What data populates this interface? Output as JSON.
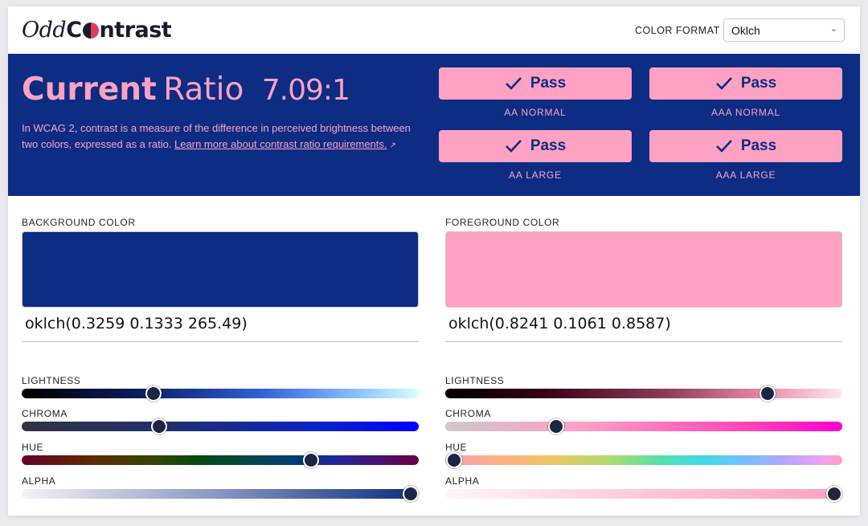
{
  "header": {
    "logo_odd": "Odd",
    "logo_c": "C",
    "logo_rest": "ntrast",
    "color_format_label": "COLOR FORMAT",
    "color_format_value": "Oklch"
  },
  "banner": {
    "title_strong": "Current",
    "title_ratio": "Ratio",
    "ratio_value": "7.09:1",
    "description": "In WCAG 2, contrast is a measure of the difference in perceived brightness between two colors, expressed as a ratio.",
    "learn_more": "Learn more about contrast ratio requirements.",
    "results": [
      {
        "label": "Pass",
        "caption": "AA NORMAL"
      },
      {
        "label": "Pass",
        "caption": "AAA NORMAL"
      },
      {
        "label": "Pass",
        "caption": "AA LARGE"
      },
      {
        "label": "Pass",
        "caption": "AAA LARGE"
      }
    ]
  },
  "background": {
    "label": "BACKGROUND COLOR",
    "swatch_color": "#0c2d83",
    "value": "oklch(0.3259 0.1333 265.49)",
    "sliders": [
      {
        "label": "LIGHTNESS",
        "level": 0.3259
      },
      {
        "label": "CHROMA",
        "level": 0.34
      },
      {
        "label": "HUE",
        "level": 0.7375
      },
      {
        "label": "ALPHA",
        "level": 1.0
      }
    ]
  },
  "foreground": {
    "label": "FOREGROUND COLOR",
    "swatch_color": "#ffa1c2",
    "value": "oklch(0.8241 0.1061 0.8587)",
    "sliders": [
      {
        "label": "LIGHTNESS",
        "level": 0.8241
      },
      {
        "label": "CHROMA",
        "level": 0.27
      },
      {
        "label": "HUE",
        "level": 0.0024
      },
      {
        "label": "ALPHA",
        "level": 1.0
      }
    ]
  },
  "colors": {
    "accent_pink": "#ffa1c2",
    "banner_navy": "#0c2d83"
  }
}
